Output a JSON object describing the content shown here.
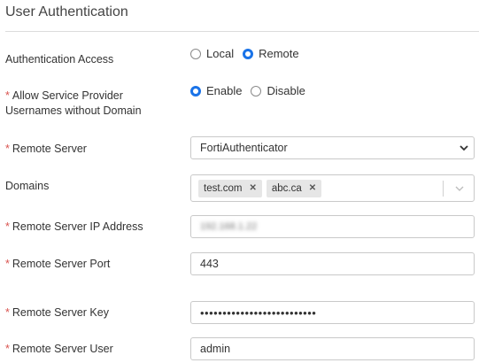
{
  "section_title": "User Authentication",
  "auth_access": {
    "label": "Authentication Access",
    "options": [
      "Local",
      "Remote"
    ],
    "selected": "Remote"
  },
  "allow_usernames": {
    "required_mark": "*",
    "label_line1": "Allow Service Provider",
    "label_line2": "Usernames without Domain",
    "options": [
      "Enable",
      "Disable"
    ],
    "selected": "Enable"
  },
  "remote_server": {
    "required_mark": "*",
    "label": "Remote Server",
    "value": "FortiAuthenticator"
  },
  "domains": {
    "label": "Domains",
    "tags": [
      "test.com",
      "abc.ca"
    ]
  },
  "remote_ip": {
    "required_mark": "*",
    "label": "Remote Server IP Address",
    "value": "192.168.1.22"
  },
  "remote_port": {
    "required_mark": "*",
    "label": "Remote Server Port",
    "value": "443"
  },
  "remote_key": {
    "required_mark": "*",
    "label": "Remote Server Key",
    "value": "••••••••••••••••••••••••••"
  },
  "remote_user": {
    "required_mark": "*",
    "label": "Remote Server User",
    "value": "admin"
  },
  "colors": {
    "accent": "#1a73e8",
    "required": "#d9534f"
  }
}
